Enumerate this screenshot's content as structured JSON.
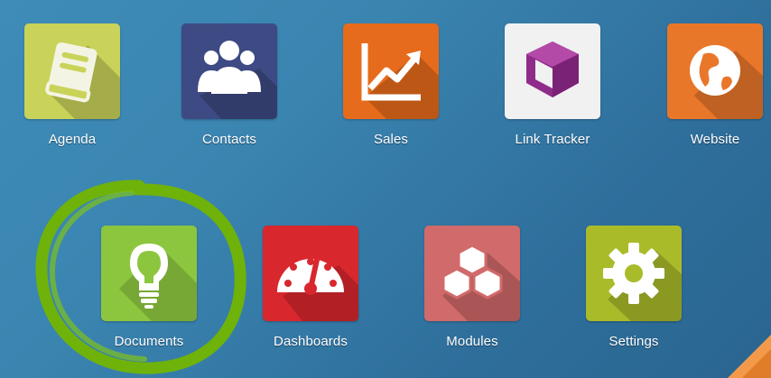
{
  "apps_row1": [
    {
      "label": "Agenda",
      "icon": "agenda-book-icon",
      "color": "#c9d35a"
    },
    {
      "label": "Contacts",
      "icon": "contacts-people-icon",
      "color": "#3d4a83"
    },
    {
      "label": "Sales",
      "icon": "sales-chart-icon",
      "color": "#e76b1c"
    },
    {
      "label": "Link Tracker",
      "icon": "link-tracker-cube-icon",
      "color": "#f1f1f1"
    },
    {
      "label": "Website",
      "icon": "website-globe-icon",
      "color": "#e9772a"
    }
  ],
  "apps_row2": [
    {
      "label": "Documents",
      "icon": "documents-lightbulb-icon",
      "color": "#8cc63f"
    },
    {
      "label": "Dashboards",
      "icon": "dashboards-gauge-icon",
      "color": "#d9272e"
    },
    {
      "label": "Modules",
      "icon": "modules-cubes-icon",
      "color": "#d16a6a"
    },
    {
      "label": "Settings",
      "icon": "settings-gear-icon",
      "color": "#aabb2a"
    }
  ],
  "annotation_color": "#6fb20a"
}
